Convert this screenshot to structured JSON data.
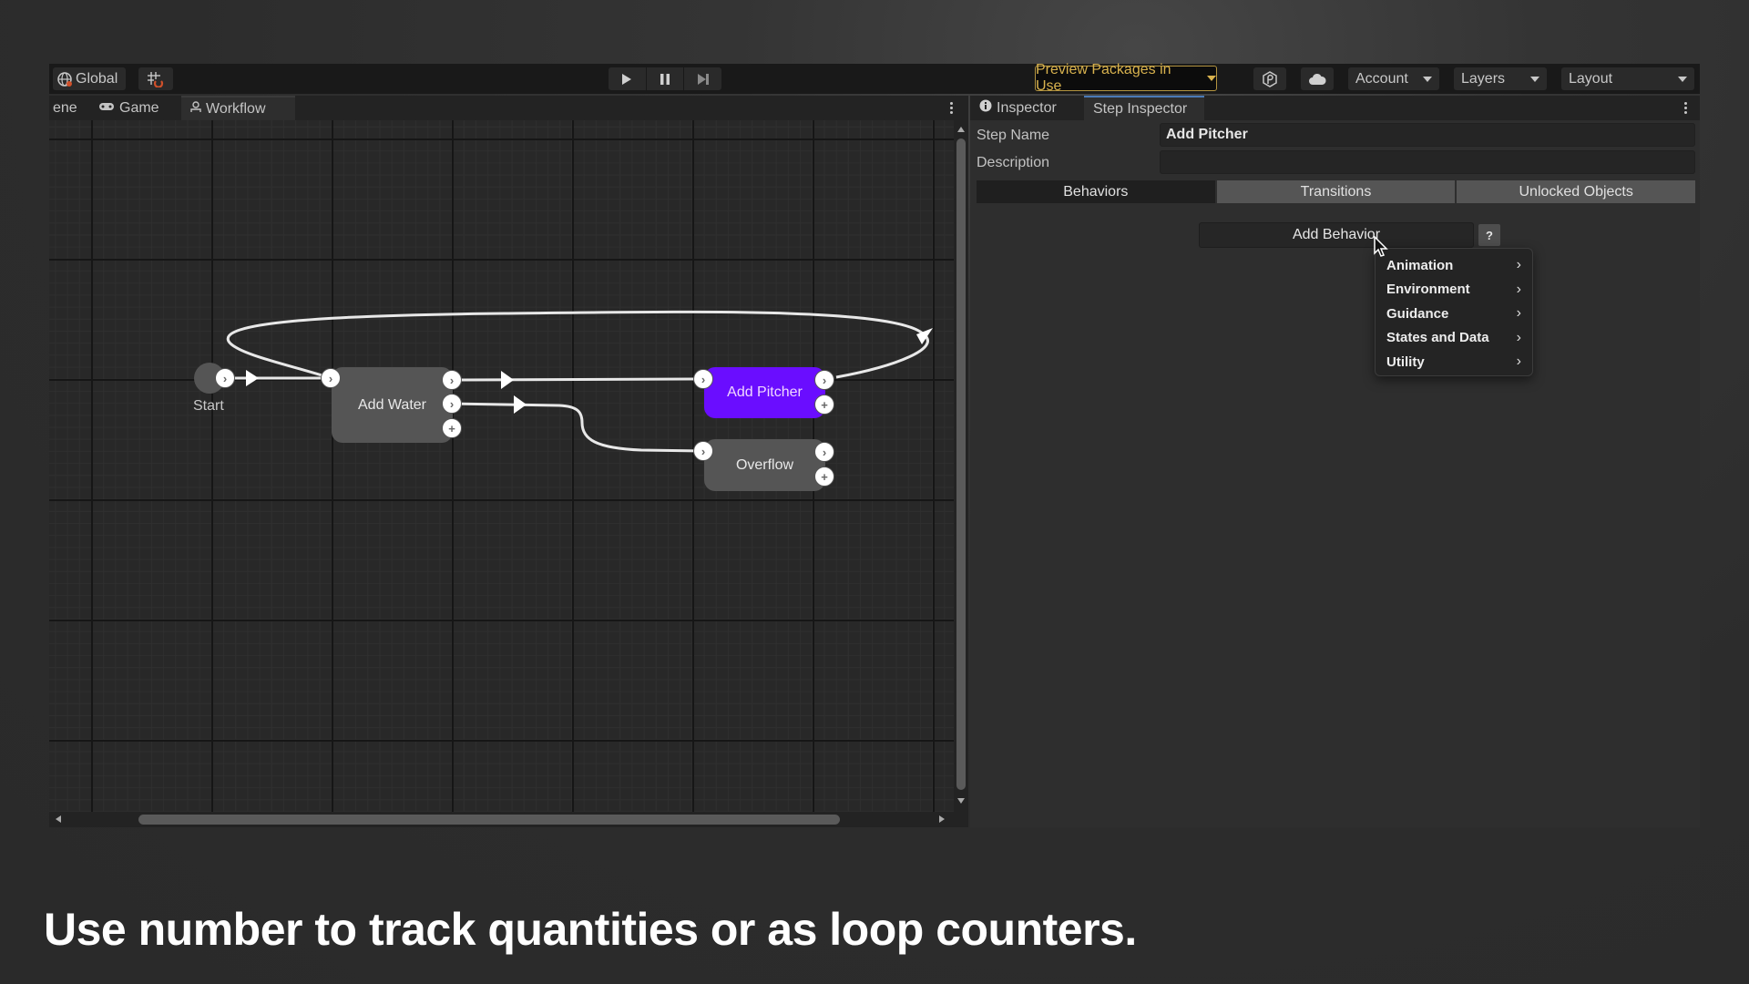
{
  "toolbar": {
    "global_label": "Global",
    "preview_packages_label": "Preview Packages in Use",
    "account_label": "Account",
    "layers_label": "Layers",
    "layout_label": "Layout",
    "accent_color": "#d8b24e"
  },
  "left_window": {
    "tabs": [
      {
        "label": "ene",
        "icon": "scene-icon"
      },
      {
        "label": "Game",
        "icon": "gamepad-icon"
      },
      {
        "label": "Workflow",
        "icon": "workflow-icon",
        "active": true
      }
    ]
  },
  "graph": {
    "nodes": {
      "start": "Start",
      "add_water": "Add Water",
      "add_pitcher": "Add Pitcher",
      "overflow": "Overflow"
    },
    "selected_node": "Add Pitcher",
    "selected_color": "#6a0dff"
  },
  "inspector": {
    "tabs": [
      {
        "label": "Inspector",
        "icon": "info-icon"
      },
      {
        "label": "Step Inspector",
        "active": true
      }
    ],
    "step_name_label": "Step Name",
    "step_name_value": "Add Pitcher",
    "description_label": "Description",
    "description_value": "",
    "segments": [
      "Behaviors",
      "Transitions",
      "Unlocked Objects"
    ],
    "active_segment": "Behaviors",
    "add_behavior_label": "Add Behavior",
    "help_label": "?",
    "menu_items": [
      "Animation",
      "Environment",
      "Guidance",
      "States and Data",
      "Utility"
    ]
  },
  "caption": "Use number to track quantities or as loop counters."
}
